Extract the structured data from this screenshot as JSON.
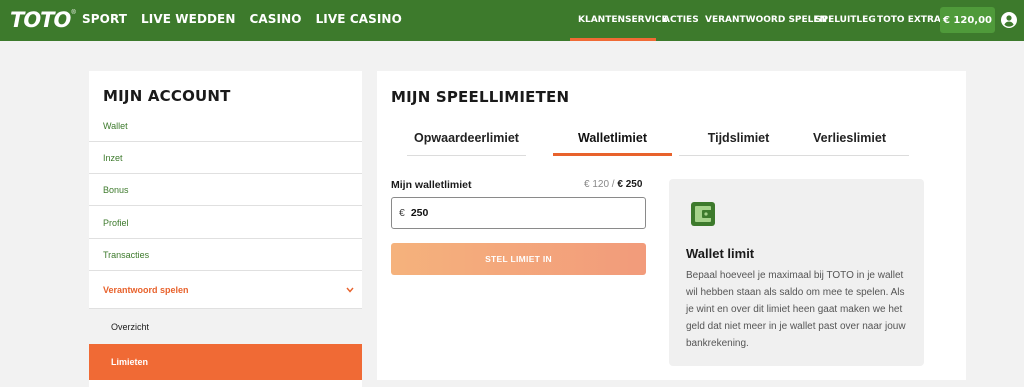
{
  "header": {
    "logo": "TOTO",
    "logo_mark": "®",
    "main_nav": [
      "SPORT",
      "LIVE WEDDEN",
      "CASINO",
      "LIVE CASINO"
    ],
    "right_nav": [
      "KLANTENSERVICE",
      "ACTIES",
      "VERANTWOORD SPELEN",
      "SPELUITLEG",
      "TOTO EXTRA"
    ],
    "active_right": "KLANTENSERVICE",
    "balance": "€ 120,00"
  },
  "sidebar": {
    "title": "MIJN ACCOUNT",
    "items": [
      "Wallet",
      "Inzet",
      "Bonus",
      "Profiel",
      "Transacties",
      "Verantwoord spelen",
      "Overzicht",
      "Limieten"
    ],
    "expanded": "Verantwoord spelen",
    "active": "Limieten"
  },
  "main": {
    "title": "MIJN SPEELLIMIETEN",
    "tabs": [
      "Opwaardeerlimiet",
      "Walletlimiet",
      "Tijdslimiet",
      "Verlieslimiet"
    ],
    "active_tab": "Walletlimiet",
    "limit_label": "Mijn walletlimiet",
    "limit_current": "€ 120 /",
    "limit_max": "€ 250",
    "input_currency": "€",
    "input_value": "250",
    "submit_label": "STEL LIMIET IN",
    "info_title": "Wallet limit",
    "info_text": "Bepaal hoeveel je maximaal bij TOTO in je wallet wil hebben staan als saldo om mee te spelen. Als je wint en over dit limiet heen gaat maken we het geld dat niet meer in je wallet past over naar jouw bankrekening."
  },
  "colors": {
    "brand_green": "#3d7a2c",
    "accent_orange": "#f06a35",
    "balance_green": "#4f9a3a"
  },
  "icons": [
    "user-icon",
    "chevron-down-icon",
    "wallet-icon"
  ]
}
